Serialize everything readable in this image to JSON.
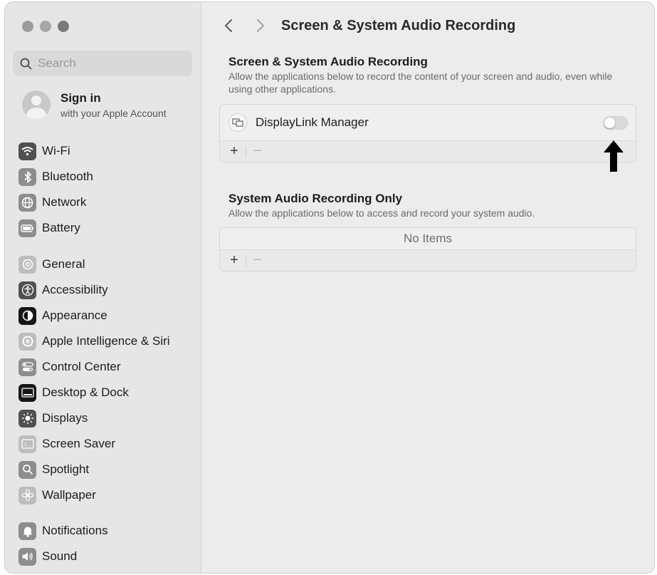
{
  "window": {
    "traffic_lights": [
      "close",
      "minimize",
      "zoom"
    ]
  },
  "sidebar": {
    "search": {
      "placeholder": "Search",
      "value": ""
    },
    "account": {
      "title": "Sign in",
      "subtitle": "with your Apple Account"
    },
    "group1": [
      {
        "label": "Wi-Fi",
        "icon": "wifi-icon"
      },
      {
        "label": "Bluetooth",
        "icon": "bluetooth-icon"
      },
      {
        "label": "Network",
        "icon": "globe-icon"
      },
      {
        "label": "Battery",
        "icon": "battery-icon"
      }
    ],
    "group2": [
      {
        "label": "General",
        "icon": "gear-icon"
      },
      {
        "label": "Accessibility",
        "icon": "accessibility-icon"
      },
      {
        "label": "Appearance",
        "icon": "appearance-icon"
      },
      {
        "label": "Apple Intelligence & Siri",
        "icon": "siri-icon"
      },
      {
        "label": "Control Center",
        "icon": "control-center-icon"
      },
      {
        "label": "Desktop & Dock",
        "icon": "desktop-dock-icon"
      },
      {
        "label": "Displays",
        "icon": "sun-icon"
      },
      {
        "label": "Screen Saver",
        "icon": "screen-saver-icon"
      },
      {
        "label": "Spotlight",
        "icon": "magnifier-icon"
      },
      {
        "label": "Wallpaper",
        "icon": "flower-icon"
      }
    ],
    "group3": [
      {
        "label": "Notifications",
        "icon": "bell-icon"
      },
      {
        "label": "Sound",
        "icon": "speaker-icon"
      }
    ]
  },
  "content": {
    "title": "Screen & System Audio Recording",
    "section1": {
      "heading": "Screen & System Audio Recording",
      "description": "Allow the applications below to record the content of your screen and audio, even while using other applications.",
      "apps": [
        {
          "name": "DisplayLink Manager",
          "icon": "displaylink-icon",
          "enabled": false
        }
      ]
    },
    "section2": {
      "heading": "System Audio Recording Only",
      "description": "Allow the applications below to access and record your system audio.",
      "empty_text": "No Items"
    },
    "add_symbol": "+",
    "remove_symbol": "−"
  },
  "annotation": {
    "icon": "up-arrow-icon",
    "color": "#000000"
  }
}
